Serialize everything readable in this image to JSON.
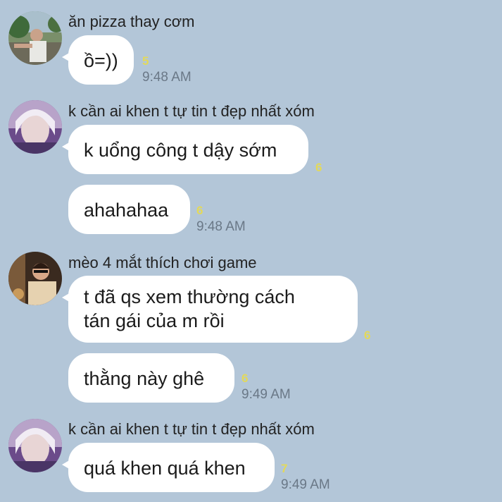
{
  "messages": [
    {
      "sender": "ăn pizza thay cơm",
      "text": "ồ=))",
      "count": "5",
      "time": "9:48 AM"
    },
    {
      "sender": "k cần ai khen t tự tin t đẹp nhất xóm",
      "text": "k uổng công t dậy sớm",
      "count": "6",
      "time": ""
    },
    {
      "sender": "",
      "text": "ahahahaa",
      "count": "6",
      "time": "9:48 AM"
    },
    {
      "sender": "mèo 4 mắt thích chơi game",
      "text_line1": "t đã qs xem thường cách",
      "text_line2": "tán gái của m rồi",
      "count": "6",
      "time": ""
    },
    {
      "sender": "",
      "text": "thằng này ghê",
      "count": "6",
      "time": "9:49 AM"
    },
    {
      "sender": "k cần ai khen t tự tin t đẹp nhất xóm",
      "text": "quá khen quá khen",
      "count": "7",
      "time": "9:49 AM"
    }
  ],
  "colors": {
    "background": "#b3c6d8",
    "bubble": "#ffffff",
    "read_count": "#e3d95a",
    "time": "#6a7887"
  }
}
